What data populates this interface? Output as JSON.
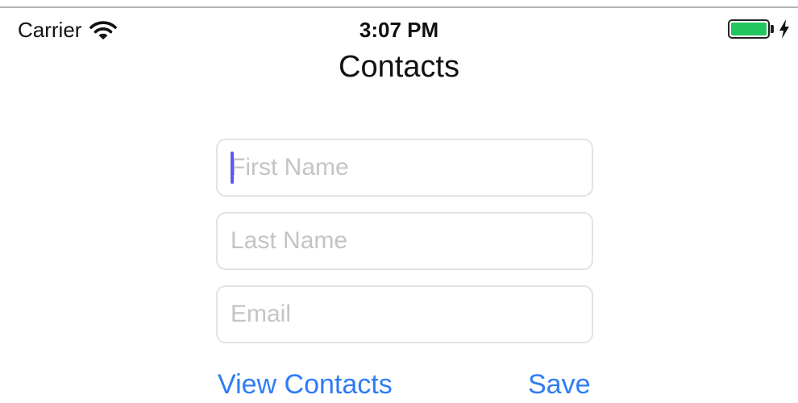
{
  "status_bar": {
    "carrier": "Carrier",
    "time": "3:07 PM",
    "wifi_icon": "wifi-icon",
    "battery_icon": "battery-icon",
    "charging_icon": "bolt-icon",
    "battery_color": "#22c55e"
  },
  "nav": {
    "title": "Contacts"
  },
  "form": {
    "first_name_placeholder": "First Name",
    "last_name_placeholder": "Last Name",
    "email_placeholder": "Email",
    "first_name_value": "",
    "last_name_value": "",
    "email_value": ""
  },
  "actions": {
    "view_contacts_label": "View Contacts",
    "save_label": "Save",
    "accent_color": "#2e7cf6"
  }
}
